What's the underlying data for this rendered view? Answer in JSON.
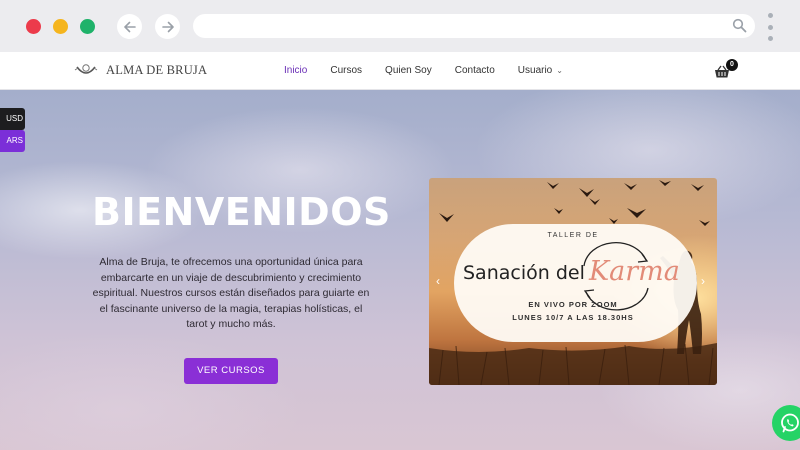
{
  "browser": {
    "icons": [
      "back-arrow-icon",
      "forward-arrow-icon",
      "search-icon",
      "kebab-menu-icon"
    ],
    "colors": {
      "red": "#ec3b4b",
      "yellow": "#f5b51e",
      "green": "#1fb26a"
    }
  },
  "header": {
    "logo_text": "ALMA DE BRUJA",
    "nav": [
      {
        "label": "Inicio",
        "active": true
      },
      {
        "label": "Cursos"
      },
      {
        "label": "Quien Soy"
      },
      {
        "label": "Contacto"
      },
      {
        "label": "Usuario",
        "has_dropdown": true
      }
    ],
    "cart_count": "0"
  },
  "currency_switcher": {
    "usd": "USD",
    "ars": "ARS"
  },
  "hero": {
    "title": "BIENVENIDOS",
    "text": "Alma de Bruja, te ofrecemos una oportunidad única para embarcarte en un viaje de descubrimiento y crecimiento espiritual. Nuestros cursos están diseñados para guiarte en el fascinante universo de la magia, terapias holísticas, el tarot y mucho más.",
    "cta": "VER CURSOS"
  },
  "slider": {
    "pre_title": "TALLER DE",
    "title_part1": "Sanación del",
    "title_part2": "Karma",
    "line1": "EN VIVO POR ZOOM",
    "line2": "LUNES 10/7 A LAS 18.30HS",
    "prev": "‹",
    "next": "›"
  },
  "colors": {
    "accent": "#8a2fd6",
    "nav_active": "#6a2fb6",
    "whatsapp": "#25d366"
  }
}
